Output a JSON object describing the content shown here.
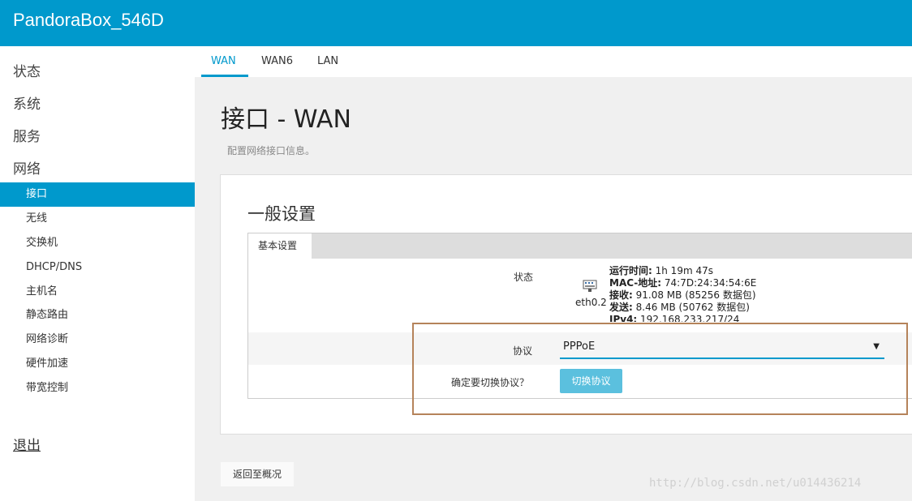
{
  "header": {
    "brand": "PandoraBox_546D"
  },
  "sidebar": {
    "top_items": [
      {
        "label": "状态"
      },
      {
        "label": "系统"
      },
      {
        "label": "服务"
      },
      {
        "label": "网络"
      }
    ],
    "sub_items": [
      {
        "label": "接口",
        "active": true
      },
      {
        "label": "无线"
      },
      {
        "label": "交换机"
      },
      {
        "label": "DHCP/DNS"
      },
      {
        "label": "主机名"
      },
      {
        "label": "静态路由"
      },
      {
        "label": "网络诊断"
      },
      {
        "label": "硬件加速"
      },
      {
        "label": "带宽控制"
      }
    ],
    "logout": "退出"
  },
  "tabs": [
    {
      "label": "WAN",
      "active": true
    },
    {
      "label": "WAN6"
    },
    {
      "label": "LAN"
    }
  ],
  "page": {
    "title": "接口 - WAN",
    "description": "配置网络接口信息。"
  },
  "general": {
    "title": "一般设置",
    "tab_label": "基本设置",
    "status_label": "状态",
    "interface": "eth0.2",
    "status_lines": [
      {
        "key": "运行时间:",
        "value": " 1h 19m 47s"
      },
      {
        "key": "MAC-地址:",
        "value": " 74:7D:24:34:54:6E"
      },
      {
        "key": "接收:",
        "value": " 91.08 MB (85256 数据包)"
      },
      {
        "key": "发送:",
        "value": " 8.46 MB (50762 数据包)"
      },
      {
        "key": "IPv4:",
        "value": " 192.168.233.217/24"
      }
    ],
    "protocol_label": "协议",
    "protocol_value": "PPPoE",
    "switch_question": "确定要切换协议？",
    "switch_button": "切换协议"
  },
  "footer": {
    "back_button": "返回至概况",
    "watermark": "http://blog.csdn.net/u014436214"
  },
  "colors": {
    "accent": "#0099cc",
    "button": "#5bc0de",
    "highlight_border": "#b5835a"
  }
}
